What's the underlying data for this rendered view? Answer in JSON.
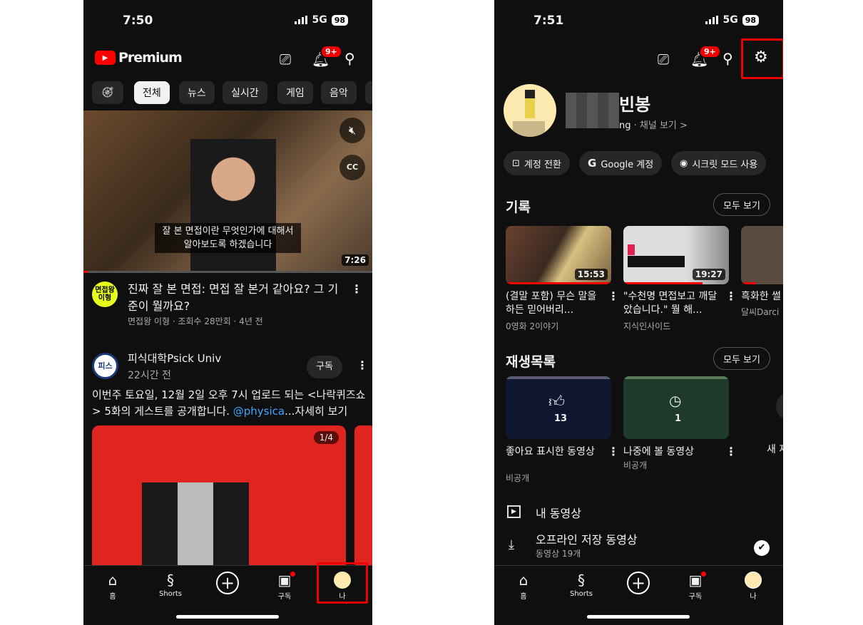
{
  "left": {
    "status": {
      "time": "7:50",
      "network": "5G",
      "battery": "98"
    },
    "header": {
      "logo": "Premium",
      "notif_badge": "9+",
      "icons": [
        "cast-icon",
        "bell-icon",
        "search-icon"
      ]
    },
    "chips": [
      "전체",
      "뉴스",
      "실시간",
      "게임",
      "음악"
    ],
    "video": {
      "subtitle_line1": "잘 본 면접이란 무엇인가에 대해서",
      "subtitle_line2": "알아보도록 하겠습니다",
      "duration": "7:26",
      "title": "진짜 잘 본 면접: 면접 잘 본거 같아요? 그 기준이 뭘까요?",
      "meta": "면접왕 이형 · 조회수 28만회 · 4년 전",
      "channel_logo": "면접왕 이형"
    },
    "post": {
      "channel": "피식대학Psick Univ",
      "time": "22시간 전",
      "subscribe": "구독",
      "text": "이번주 토요일, 12월 2일 오후 7시 업로드 되는 <나락퀴즈쇼> 5화의 게스트를 공개합니다. ",
      "mention": "@physica",
      "more": "...자세히 보기",
      "image_counter": "1/4",
      "avatar_text": "피스"
    },
    "nav": [
      "홈",
      "Shorts",
      "",
      "구독",
      "나"
    ]
  },
  "right": {
    "status": {
      "time": "7:51",
      "network": "5G",
      "battery": "98"
    },
    "header": {
      "notif_badge": "9+"
    },
    "profile": {
      "name": "빈봉",
      "handle": "ng",
      "channel_link": "채널 보기 >"
    },
    "actions": [
      "계정 전환",
      "Google 계정",
      "시크릿 모드 사용"
    ],
    "history": {
      "heading": "기록",
      "view_all": "모두 보기",
      "items": [
        {
          "title": "(결말 포함) 무슨 말을 하든 믿어버리...",
          "channel": "0영화 2이야기",
          "duration": "15:53"
        },
        {
          "title": "\"수천명 면접보고 깨달았습니다.\" 뭘 해...",
          "channel": "지식인사이드",
          "duration": "19:27"
        },
        {
          "title": "흑화한 썰",
          "channel": "달씨Darci"
        }
      ]
    },
    "playlists": {
      "heading": "재생목록",
      "view_all": "모두 보기",
      "items": [
        {
          "title": "좋아요 표시한 동영상",
          "privacy": "비공개",
          "count": "13"
        },
        {
          "title": "나중에 볼 동영상",
          "privacy": "비공개",
          "count": "1"
        }
      ],
      "new_label": "새 재"
    },
    "my_videos": "내 동영상",
    "offline": {
      "title": "오프라인 저장 동영상",
      "count": "동영상 19개"
    },
    "nav": [
      "홈",
      "Shorts",
      "",
      "구독",
      "나"
    ]
  },
  "colors": {
    "accent": "#ff0000",
    "background": "#0f0f0f",
    "link": "#3ea6ff",
    "highlight": "#e00000"
  }
}
